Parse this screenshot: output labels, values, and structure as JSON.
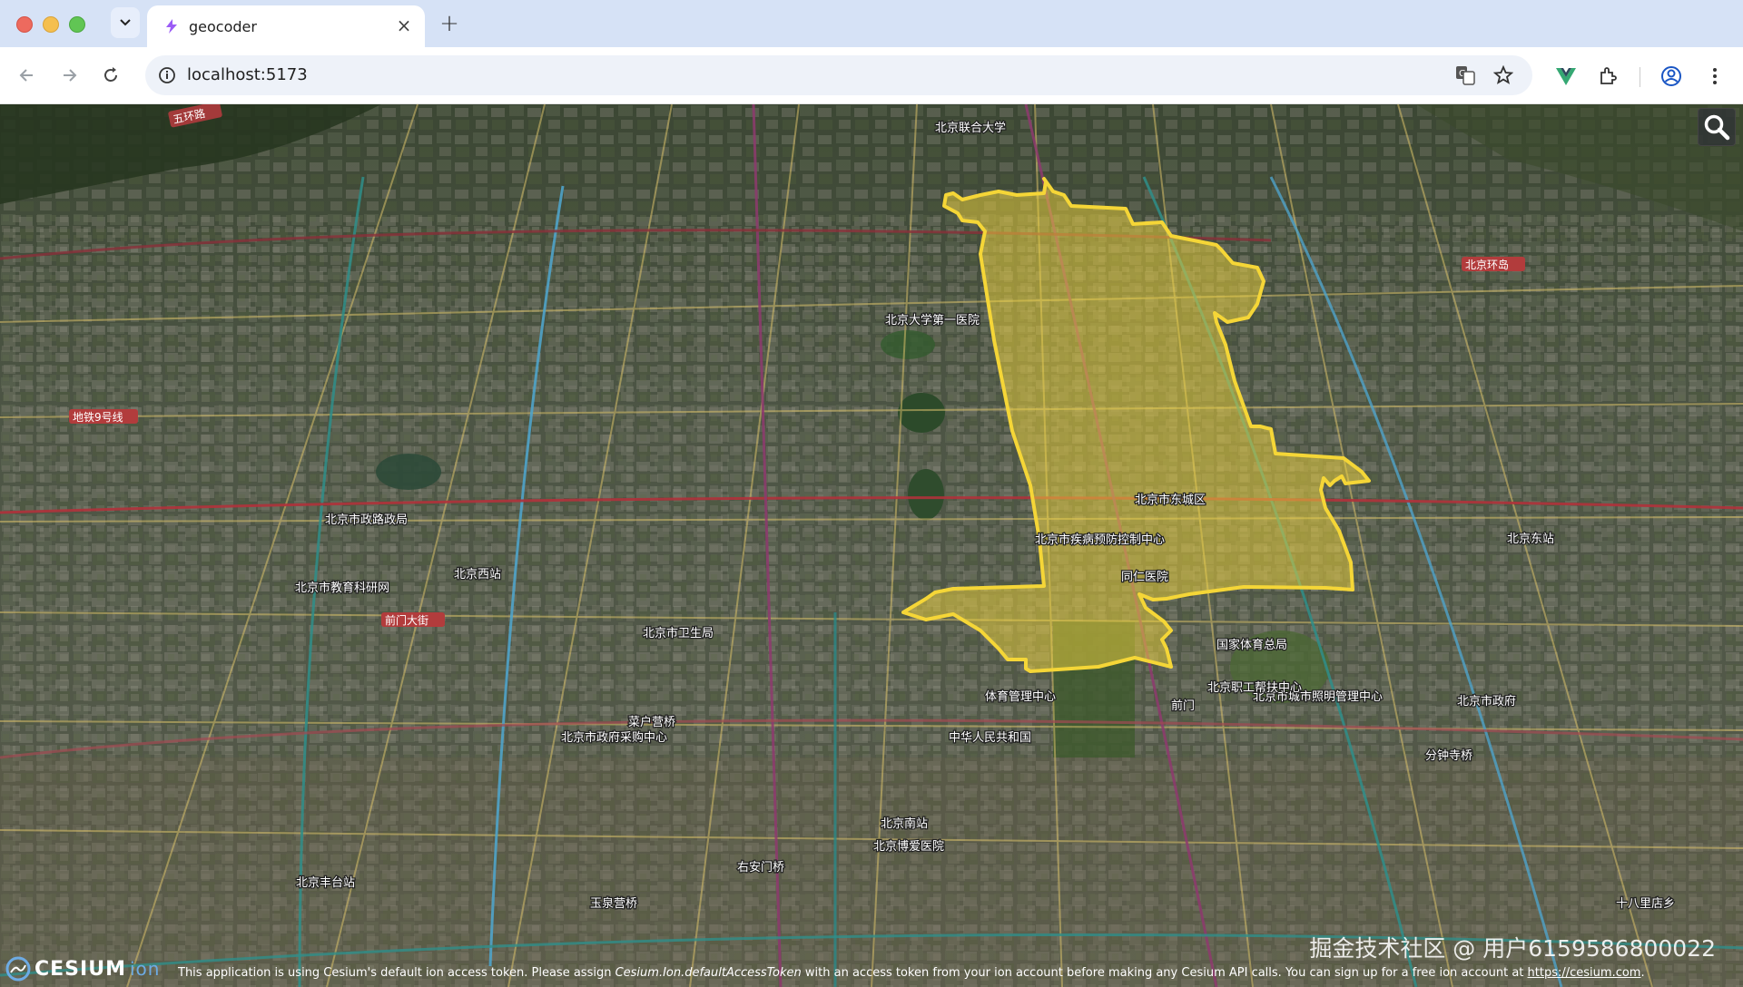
{
  "browser": {
    "tab_title": "geocoder",
    "tab_close": "×",
    "new_tab": "+",
    "url": "localhost:5173"
  },
  "map": {
    "road_labels": {
      "ring5": "五环路",
      "beijing_ring": "北京环岛",
      "qianmen": "前门大街",
      "dijia": "地铁9号线"
    },
    "labels": [
      {
        "id": "northwest",
        "text": "北京联合大学"
      },
      {
        "id": "beijing_west",
        "text": "北京西站"
      },
      {
        "id": "beijing_south",
        "text": "北京南站"
      },
      {
        "id": "fengtai",
        "text": "北京丰台站"
      },
      {
        "id": "tongzhou",
        "text": "北京市政府"
      },
      {
        "id": "east_station",
        "text": "北京东站"
      },
      {
        "id": "tongren",
        "text": "同仁医院"
      },
      {
        "id": "jiankong",
        "text": "北京市疾病预防控制中心"
      },
      {
        "id": "chongwen",
        "text": "北京市城市照明管理中心"
      },
      {
        "id": "taoranting",
        "text": "北京市政府采购中心"
      },
      {
        "id": "youanmen",
        "text": "右安门桥"
      },
      {
        "id": "yuquanying",
        "text": "玉泉营桥"
      },
      {
        "id": "caishikou",
        "text": "菜户营桥"
      },
      {
        "id": "xizhimen",
        "text": "北京市政路政局"
      },
      {
        "id": "qianmen",
        "text": "前门"
      },
      {
        "id": "xuanwu",
        "text": "北京市卫生局"
      },
      {
        "id": "jingqu",
        "text": "体育管理中心"
      },
      {
        "id": "xianghe",
        "text": "中华人民共和国"
      },
      {
        "id": "wanfang",
        "text": "北京博爱医院"
      },
      {
        "id": "shilipu",
        "text": "十八里店乡"
      },
      {
        "id": "guangqumen",
        "text": "分钟寺桥"
      },
      {
        "id": "zhongguancun",
        "text": "北京大学第一医院"
      },
      {
        "id": "gongzhufen",
        "text": "北京市教育科研网"
      },
      {
        "id": "cbd",
        "text": "北京职工帮扶中心"
      },
      {
        "id": "tiantan",
        "text": "国家体育总局"
      },
      {
        "id": "dongsi",
        "text": "北京市东城区"
      }
    ]
  },
  "ui": {
    "search_icon": "search-icon"
  },
  "credits": {
    "logo": "CESIUM",
    "logo_ion": "ion",
    "text_before": "This application is using Cesium's default ion access token. Please assign ",
    "text_code": "Cesium.Ion.defaultAccessToken",
    "text_after": " with an access token from your ion account before making any Cesium API calls. You can sign up for a free ion account at ",
    "link": "https://cesium.com",
    "text_end": "."
  },
  "watermark": "掘金技术社区 @ 用户6159586800022"
}
